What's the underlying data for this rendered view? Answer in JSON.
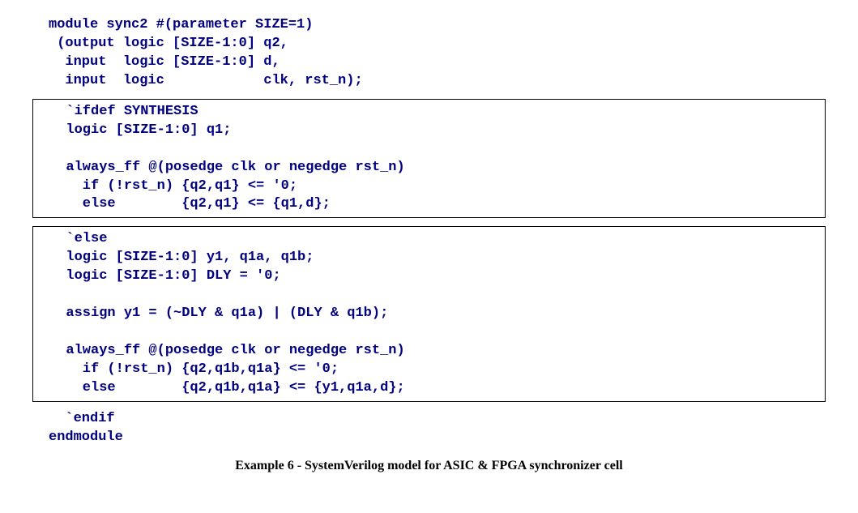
{
  "header": {
    "line1": "module sync2 #(parameter SIZE=1)",
    "line2": " (output logic [SIZE-1:0] q2,",
    "line3": "  input  logic [SIZE-1:0] d,",
    "line4": "  input  logic            clk, rst_n);"
  },
  "box1": {
    "line1": "  `ifdef SYNTHESIS",
    "line2": "  logic [SIZE-1:0] q1;",
    "blank1": "",
    "line3": "  always_ff @(posedge clk or negedge rst_n)",
    "line4": "    if (!rst_n) {q2,q1} <= '0;",
    "line5": "    else        {q2,q1} <= {q1,d};"
  },
  "box2": {
    "line1": "  `else",
    "line2": "  logic [SIZE-1:0] y1, q1a, q1b;",
    "line3": "  logic [SIZE-1:0] DLY = '0;",
    "blank1": "",
    "line4": "  assign y1 = (~DLY & q1a) | (DLY & q1b);",
    "blank2": "",
    "line5": "  always_ff @(posedge clk or negedge rst_n)",
    "line6": "    if (!rst_n) {q2,q1b,q1a} <= '0;",
    "line7": "    else        {q2,q1b,q1a} <= {y1,q1a,d};"
  },
  "footer": {
    "line1": "  `endif",
    "line2": "endmodule"
  },
  "caption": "Example 6 - SystemVerilog model for ASIC & FPGA synchronizer cell"
}
